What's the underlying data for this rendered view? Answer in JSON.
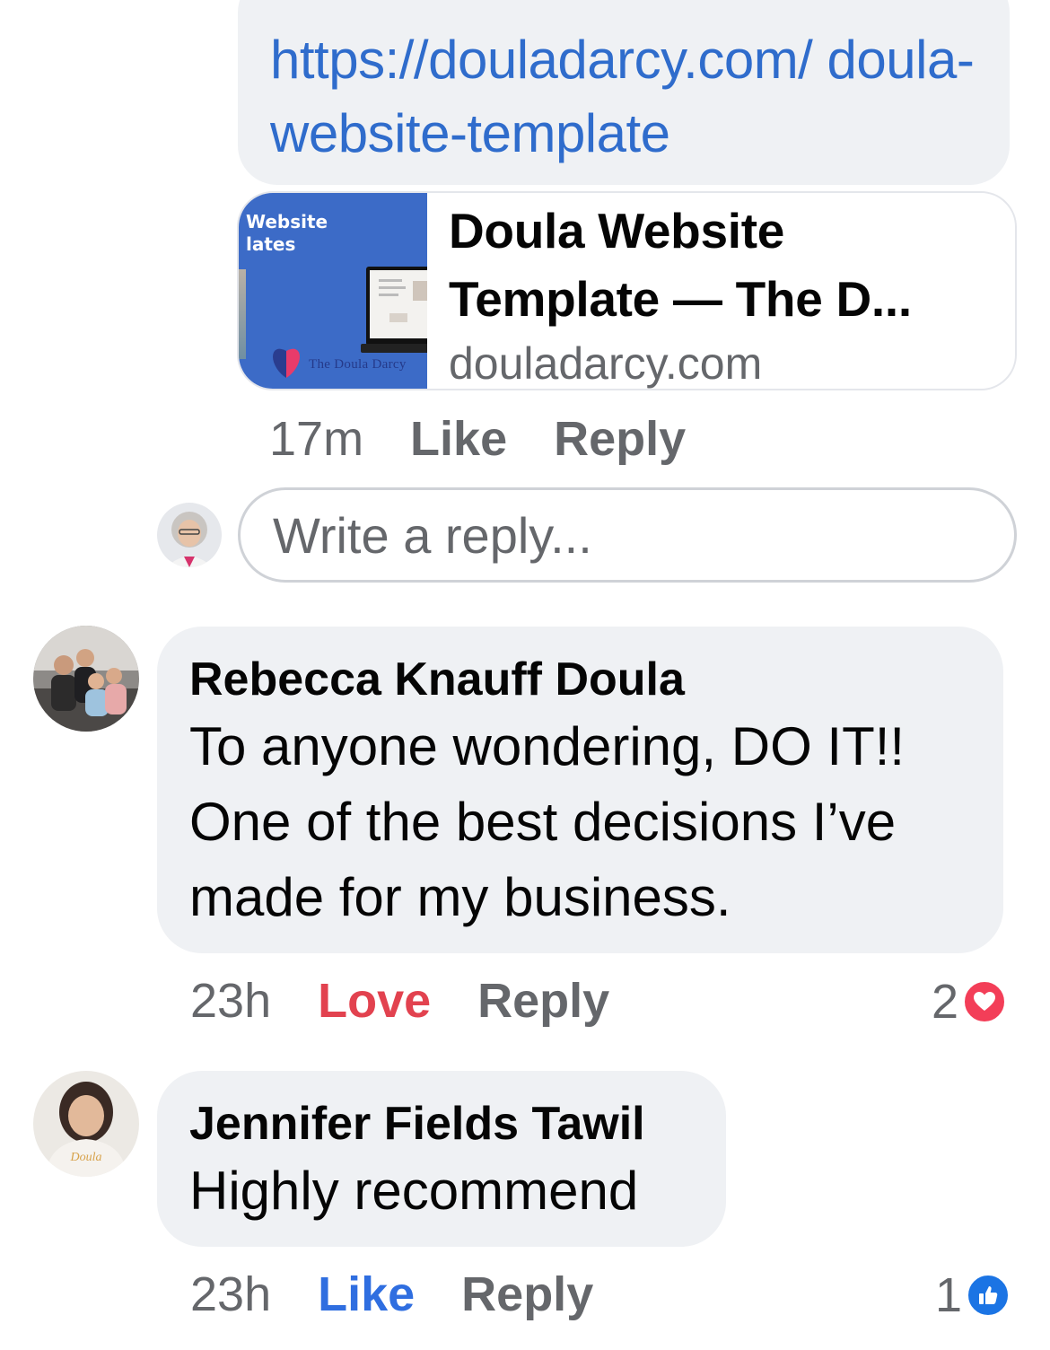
{
  "link_comment": {
    "url_text": "https://douladarcy.com/ doula-website-template",
    "preview": {
      "thumbnail_text": "Website\nlates",
      "thumbnail_logo": "The Doula Darcy",
      "title": "Doula Website Template — The D...",
      "domain": "douladarcy.com"
    },
    "time": "17m",
    "like_label": "Like",
    "reply_label": "Reply"
  },
  "reply_box": {
    "placeholder": "Write a reply..."
  },
  "comments": [
    {
      "author": "Rebecca Knauff Doula",
      "text": "To anyone wondering, DO IT!! One of the best decisions I’ve made for my business.",
      "time": "23h",
      "reaction_label": "Love",
      "reply_label": "Reply",
      "reaction_count": "2",
      "reaction_icon": "heart-icon",
      "reaction_color": "#e2424f"
    },
    {
      "author": "Jennifer Fields Tawil",
      "text": "Highly recommend",
      "time": "23h",
      "reaction_label": "Like",
      "reply_label": "Reply",
      "reaction_count": "1",
      "reaction_icon": "thumbs-up-icon",
      "reaction_color": "#2f6ee0"
    }
  ]
}
